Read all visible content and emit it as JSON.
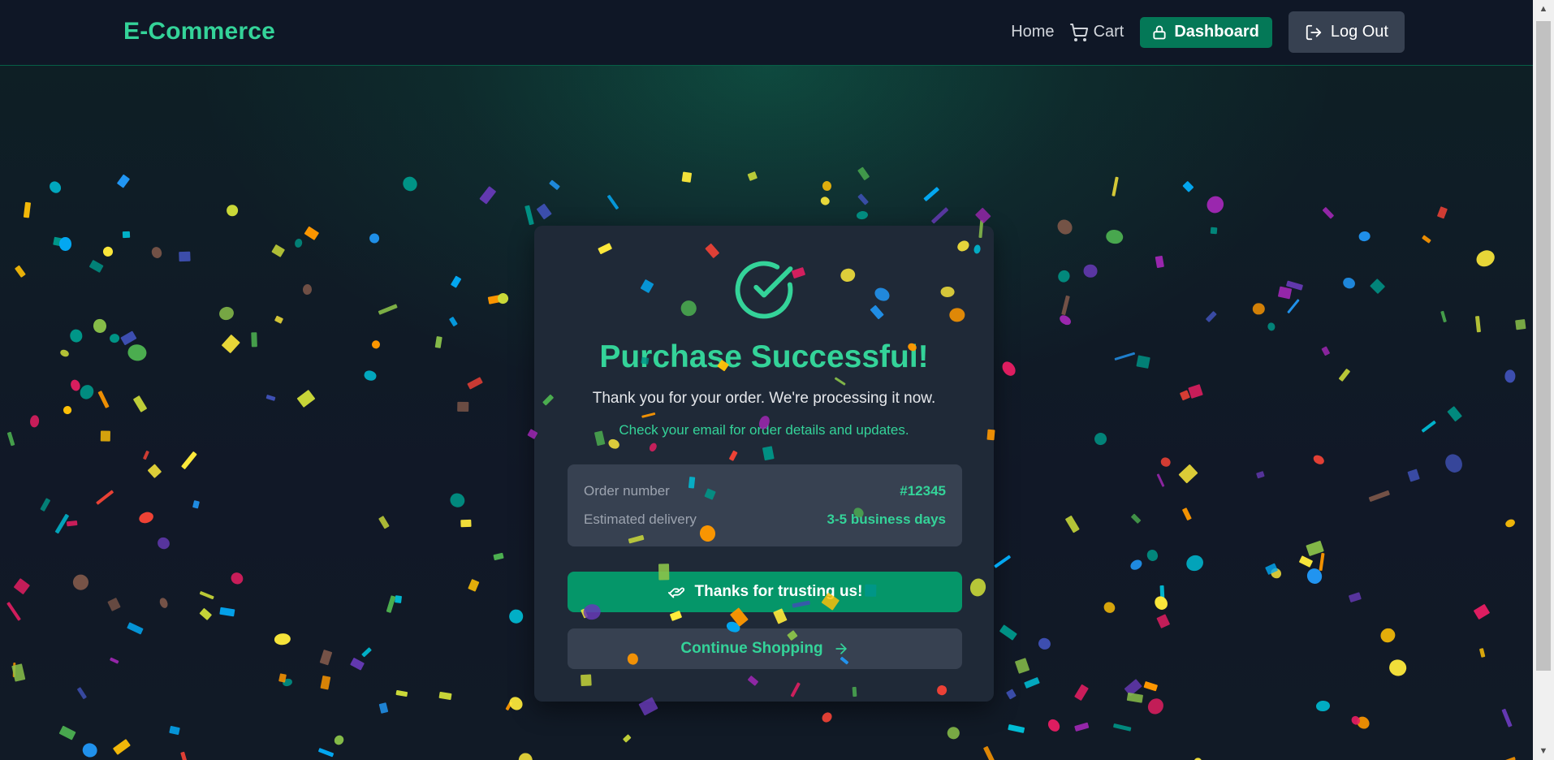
{
  "header": {
    "brand": "E-Commerce",
    "nav": {
      "home": "Home",
      "cart": "Cart",
      "dashboard": "Dashboard",
      "logout": "Log Out"
    }
  },
  "card": {
    "title": "Purchase Successful!",
    "subtitle": "Thank you for your order. We're processing it now.",
    "note": "Check your email for order details and updates.",
    "details": [
      {
        "label": "Order number",
        "value": "#12345"
      },
      {
        "label": "Estimated delivery",
        "value": "3-5 business days"
      }
    ],
    "primary_button": "Thanks for trusting us!",
    "secondary_button": "Continue Shopping"
  },
  "icons": {
    "cart": "cart-icon",
    "dashboard": "lock-icon",
    "logout": "logout-icon",
    "success": "check-circle-icon",
    "handshake": "handshake-icon",
    "arrow": "arrow-right-icon"
  },
  "colors": {
    "accent": "#34d399",
    "primary_button": "#059669",
    "dashboard_button": "#047857",
    "card_bg": "#1f2937",
    "page_bg": "#111827"
  }
}
